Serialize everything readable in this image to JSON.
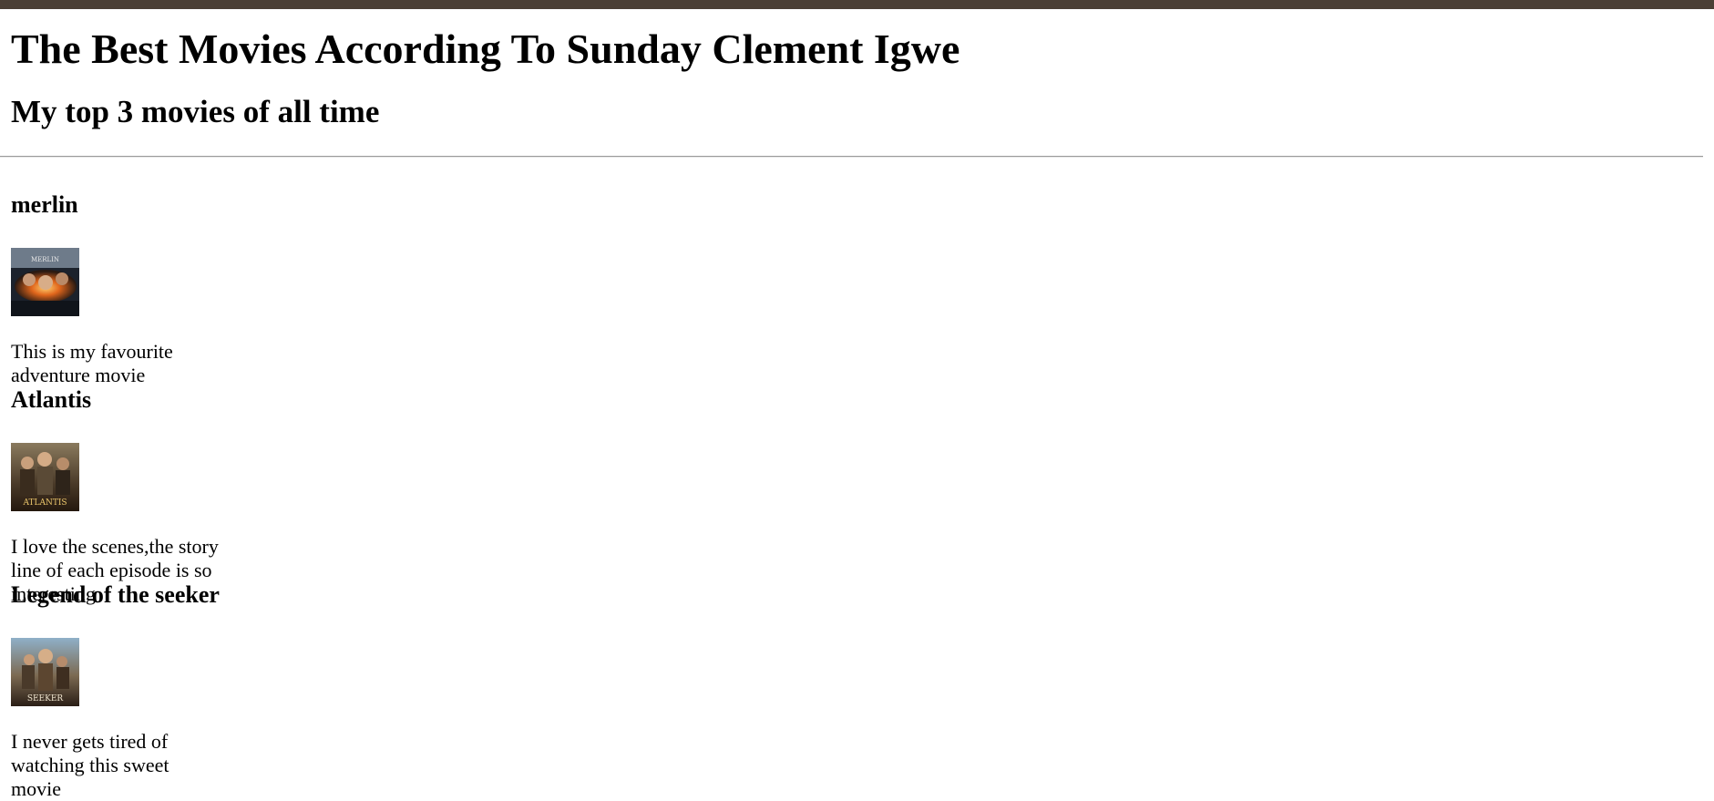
{
  "page": {
    "title": "The Best Movies According To Sunday Clement Igwe",
    "subtitle": "My top 3 movies of all time"
  },
  "movies": [
    {
      "title": "merlin",
      "poster_caption": "MERLIN",
      "description": "This is my favourite adventure movie"
    },
    {
      "title": "Atlantis",
      "poster_caption": "ATLANTIS",
      "description": "I love the scenes,the story line of each episode is so interesting"
    },
    {
      "title": "Legend of the seeker",
      "poster_caption": "SEEKER",
      "description": "I never gets tired of watching this sweet movie"
    }
  ],
  "colors": {
    "topbar": "#4b3f35",
    "text": "#000000",
    "rule": "#9a9a9a"
  }
}
